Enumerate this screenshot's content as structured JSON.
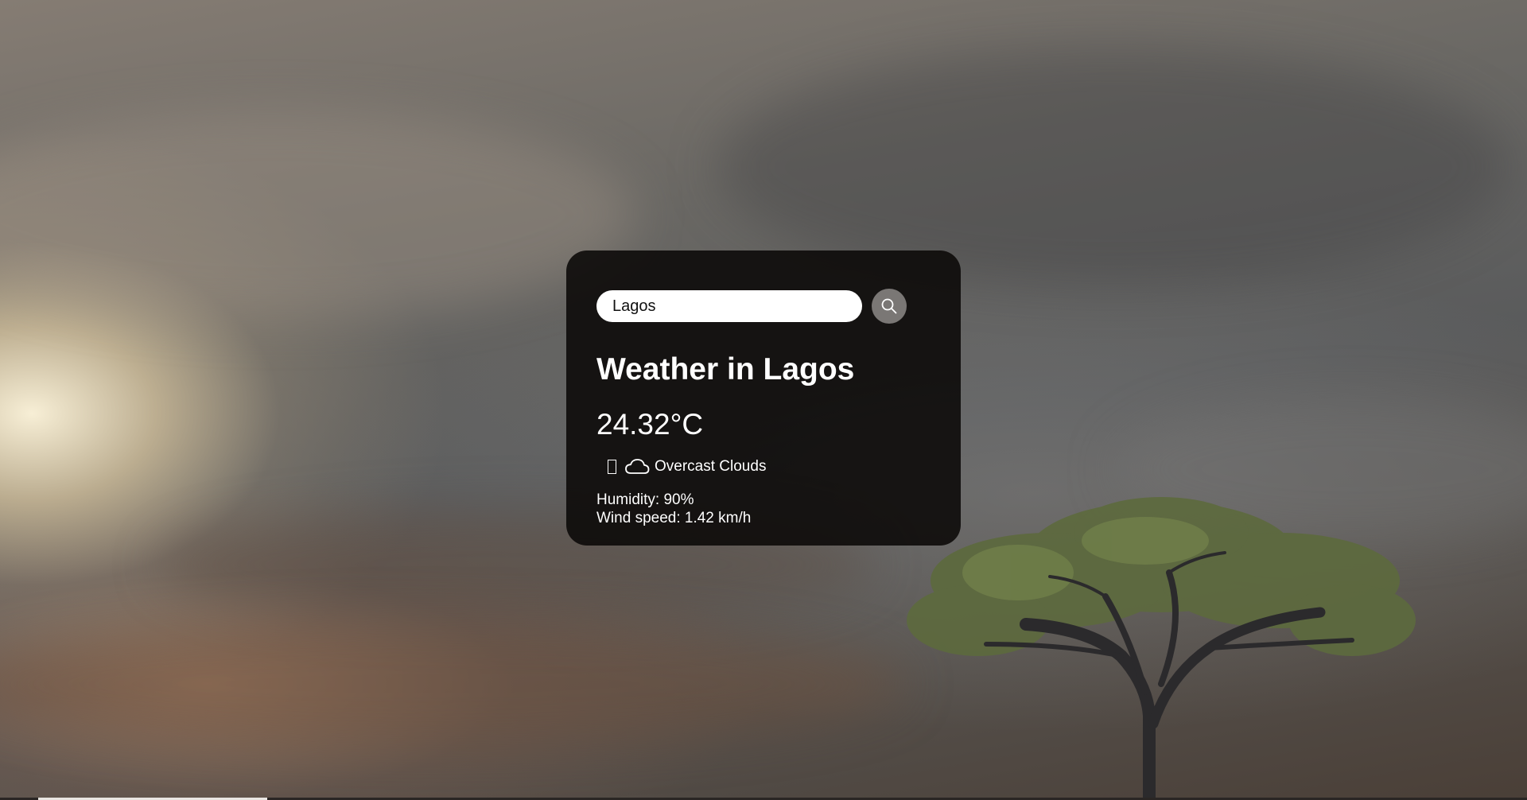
{
  "search": {
    "value": "Lagos",
    "button_icon": "search-icon"
  },
  "weather": {
    "title": "Weather in Lagos",
    "temperature": "24.32°C",
    "description": "Overcast Clouds",
    "condition_icon": "cloud-icon",
    "humidity": "Humidity: 90%",
    "wind": "Wind speed: 1.42 km/h"
  },
  "colors": {
    "card_background": "#0a0807",
    "search_button": "#7a7775",
    "text": "#ffffff"
  }
}
